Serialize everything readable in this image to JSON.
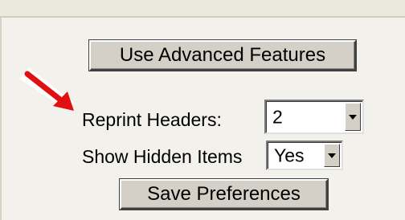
{
  "buttons": {
    "advanced_label": "Use Advanced Features",
    "save_label": "Save Preferences"
  },
  "fields": {
    "reprint_headers": {
      "label": "Reprint Headers:",
      "value": "2"
    },
    "show_hidden_items": {
      "label": "Show Hidden Items",
      "value": "Yes"
    }
  },
  "annotation": {
    "arrow_icon": "red-arrow-icon",
    "arrow_color": "#e01010"
  },
  "colors": {
    "background": "#f2f1ec",
    "button_face": "#d4d0c8"
  }
}
